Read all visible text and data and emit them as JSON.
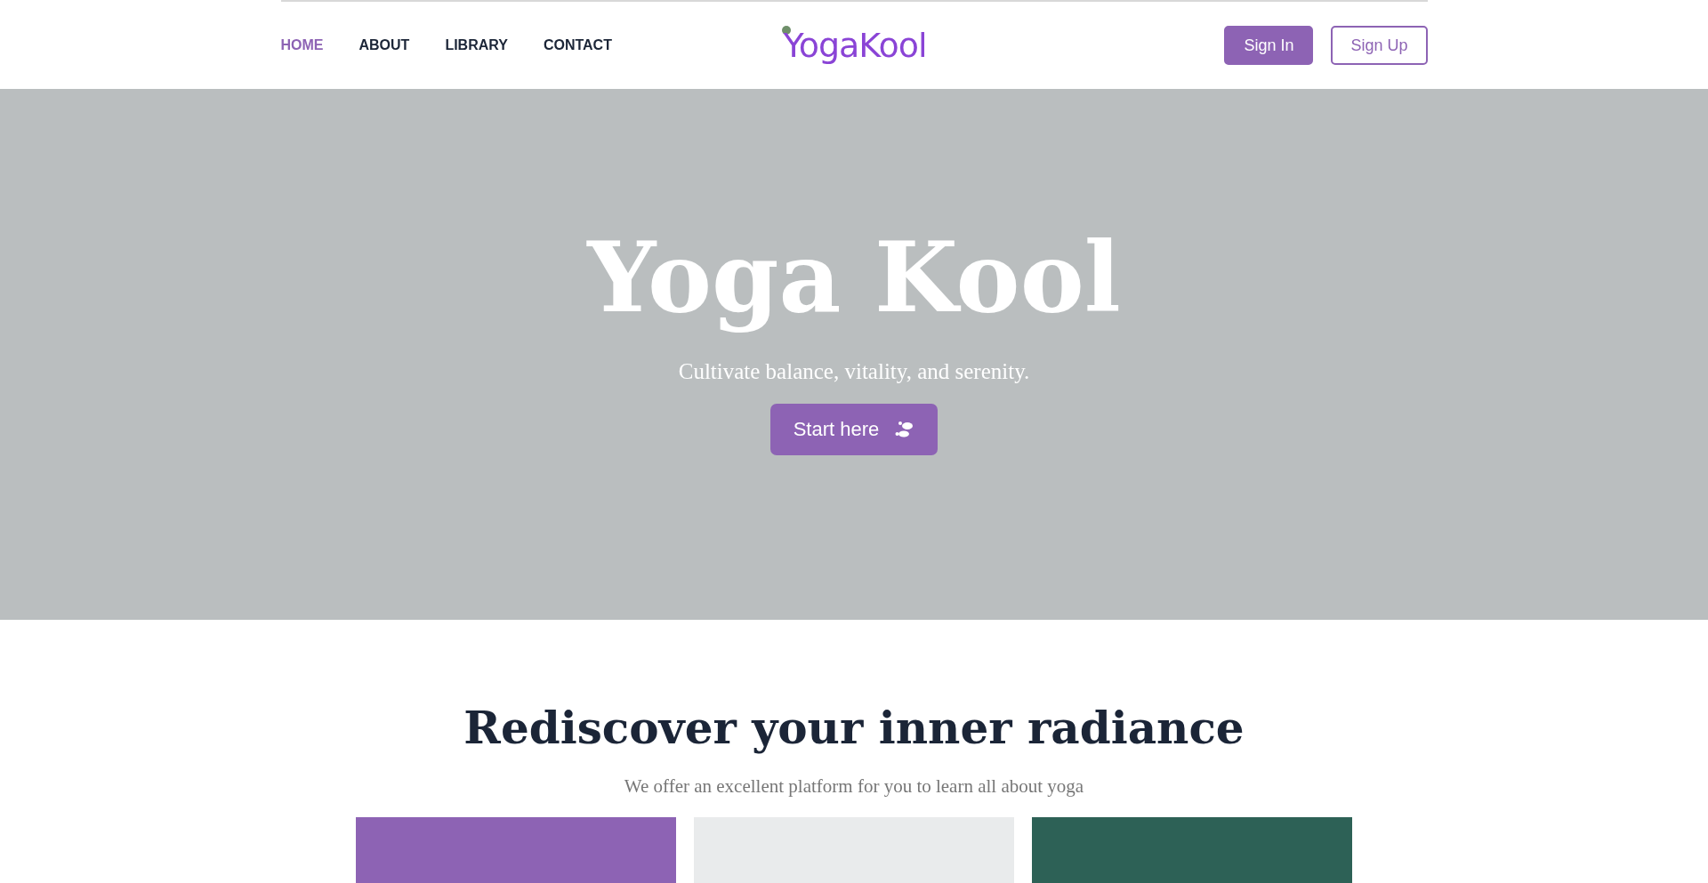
{
  "nav": {
    "links": [
      {
        "label": "HOME",
        "selected": true
      },
      {
        "label": "ABOUT",
        "selected": false
      },
      {
        "label": "LIBRARY",
        "selected": false
      },
      {
        "label": "CONTACT",
        "selected": false
      }
    ],
    "logo": "YogaKool",
    "buttons": [
      {
        "label": "Sign In",
        "kind": "filled"
      },
      {
        "label": "Sign Up",
        "kind": "outline"
      }
    ]
  },
  "hero": {
    "title": "Yoga Kool",
    "subtitle": "Cultivate balance, vitality, and serenity.",
    "cta": "Start here"
  },
  "intro": {
    "heading": "Rediscover your inner radiance",
    "text": "We offer an excellent platform for you to learn all about yoga"
  },
  "cards": [
    {
      "color": "#8d63b4"
    },
    {
      "color": "#e9ebec"
    },
    {
      "color": "#2d6156"
    }
  ]
}
